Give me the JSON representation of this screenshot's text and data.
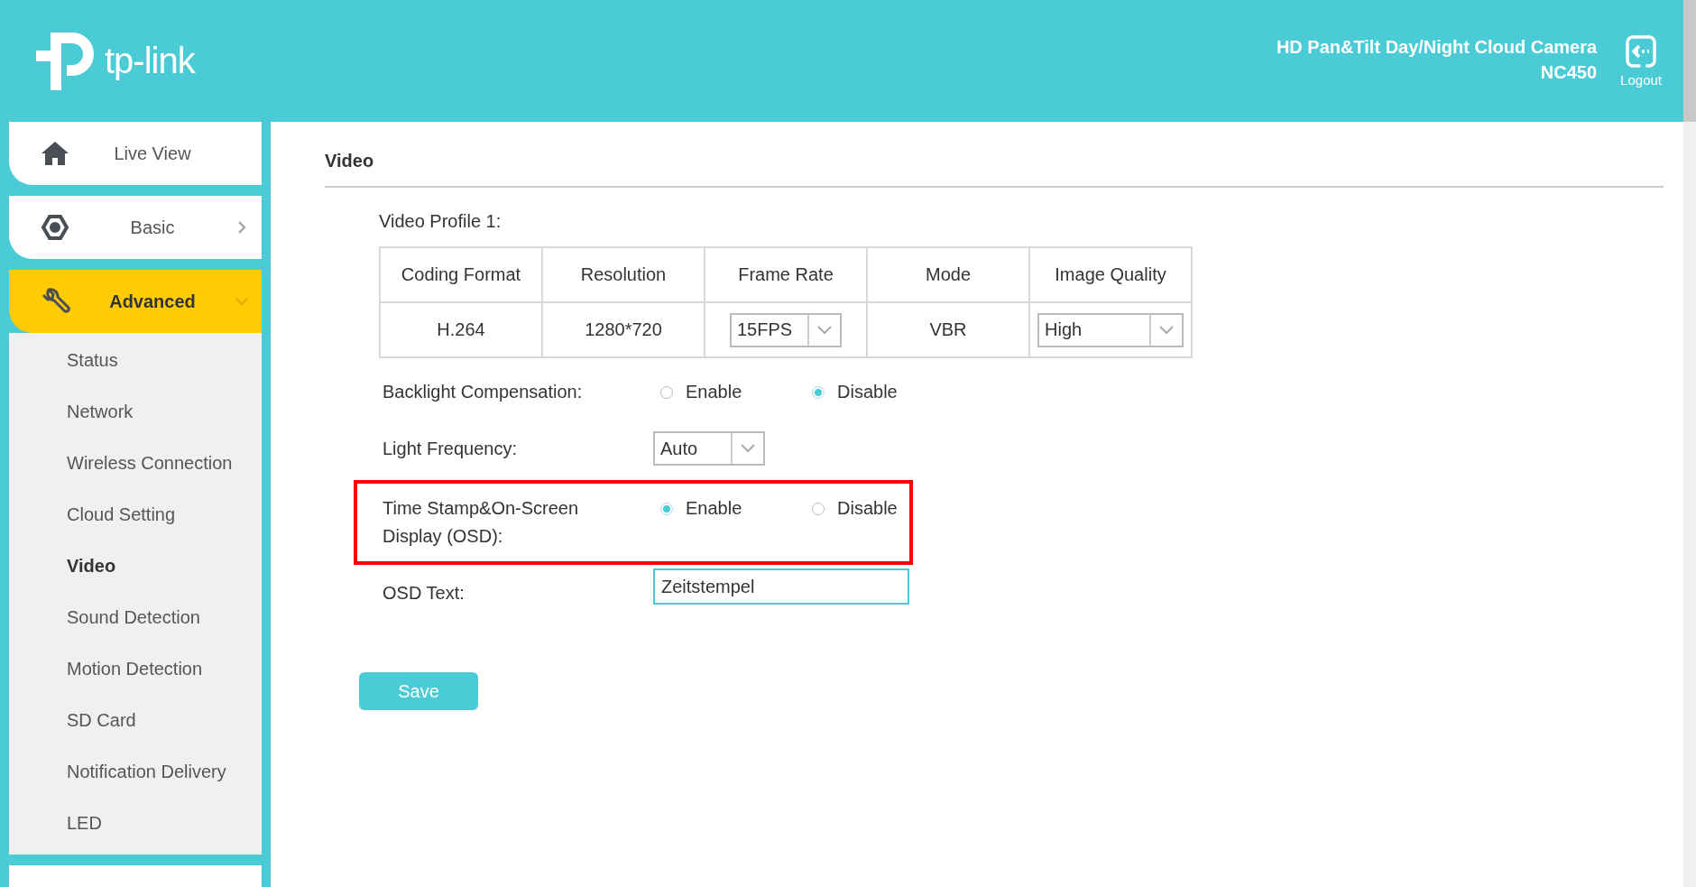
{
  "header": {
    "logo_text": "tp-link",
    "product_name": "HD Pan&Tilt Day/Night Cloud Camera",
    "model": "NC450",
    "logout_label": "Logout"
  },
  "sidebar": {
    "items": [
      {
        "label": "Live View",
        "selected": false
      },
      {
        "label": "Basic",
        "selected": false,
        "expanded": false
      },
      {
        "label": "Advanced",
        "selected": true,
        "expanded": true,
        "children": [
          {
            "label": "Status",
            "selected": false
          },
          {
            "label": "Network",
            "selected": false
          },
          {
            "label": "Wireless Connection",
            "selected": false
          },
          {
            "label": "Cloud Setting",
            "selected": false
          },
          {
            "label": "Video",
            "selected": true
          },
          {
            "label": "Sound Detection",
            "selected": false
          },
          {
            "label": "Motion Detection",
            "selected": false
          },
          {
            "label": "SD Card",
            "selected": false
          },
          {
            "label": "Notification Delivery",
            "selected": false
          },
          {
            "label": "LED",
            "selected": false
          }
        ]
      }
    ]
  },
  "content": {
    "title": "Video",
    "profile_label": "Video Profile 1:",
    "table": {
      "columns": [
        "Coding Format",
        "Resolution",
        "Frame Rate",
        "Mode",
        "Image Quality"
      ],
      "rows": [
        [
          {
            "kind": "text",
            "value": "H.264"
          },
          {
            "kind": "text",
            "value": "1280*720"
          },
          {
            "kind": "select",
            "value": "15FPS"
          },
          {
            "kind": "text",
            "value": "VBR"
          },
          {
            "kind": "select",
            "value": "High"
          }
        ]
      ]
    },
    "settings": [
      {
        "kind": "radio",
        "label": "Backlight Compensation:",
        "highlighted": false,
        "options": [
          {
            "label": "Enable",
            "selected": false
          },
          {
            "label": "Disable",
            "selected": true
          }
        ]
      },
      {
        "kind": "select",
        "label": "Light Frequency:",
        "highlighted": false,
        "value": "Auto"
      },
      {
        "kind": "radio",
        "label": "Time Stamp&On-Screen Display (OSD):",
        "highlighted": true,
        "options": [
          {
            "label": "Enable",
            "selected": true
          },
          {
            "label": "Disable",
            "selected": false
          }
        ]
      },
      {
        "kind": "text",
        "label": "OSD Text:",
        "highlighted": false,
        "value": "Zeitstempel"
      }
    ],
    "save_label": "Save"
  }
}
